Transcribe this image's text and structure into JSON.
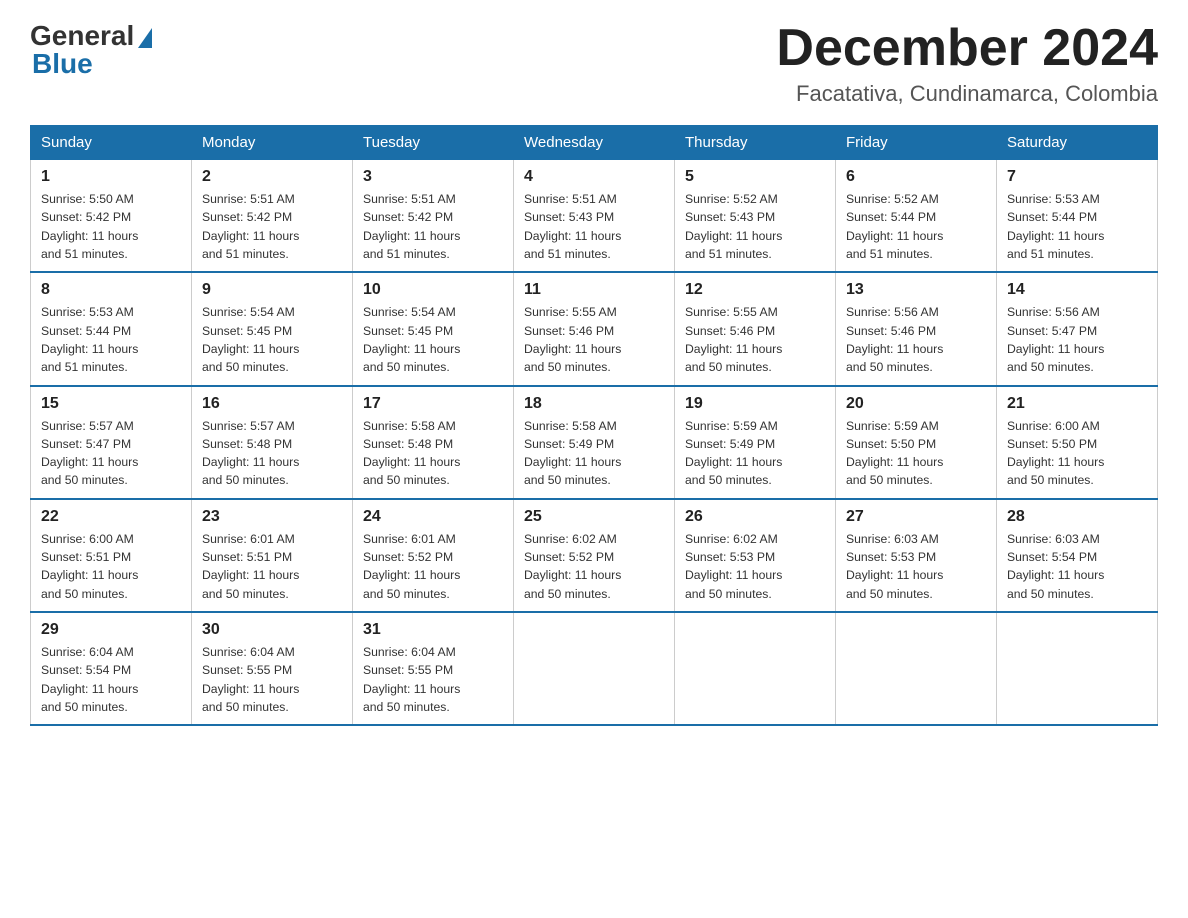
{
  "logo": {
    "general": "General",
    "blue": "Blue"
  },
  "title": "December 2024",
  "subtitle": "Facatativa, Cundinamarca, Colombia",
  "days_of_week": [
    "Sunday",
    "Monday",
    "Tuesday",
    "Wednesday",
    "Thursday",
    "Friday",
    "Saturday"
  ],
  "weeks": [
    [
      {
        "day": "1",
        "sunrise": "5:50 AM",
        "sunset": "5:42 PM",
        "daylight": "11 hours and 51 minutes."
      },
      {
        "day": "2",
        "sunrise": "5:51 AM",
        "sunset": "5:42 PM",
        "daylight": "11 hours and 51 minutes."
      },
      {
        "day": "3",
        "sunrise": "5:51 AM",
        "sunset": "5:42 PM",
        "daylight": "11 hours and 51 minutes."
      },
      {
        "day": "4",
        "sunrise": "5:51 AM",
        "sunset": "5:43 PM",
        "daylight": "11 hours and 51 minutes."
      },
      {
        "day": "5",
        "sunrise": "5:52 AM",
        "sunset": "5:43 PM",
        "daylight": "11 hours and 51 minutes."
      },
      {
        "day": "6",
        "sunrise": "5:52 AM",
        "sunset": "5:44 PM",
        "daylight": "11 hours and 51 minutes."
      },
      {
        "day": "7",
        "sunrise": "5:53 AM",
        "sunset": "5:44 PM",
        "daylight": "11 hours and 51 minutes."
      }
    ],
    [
      {
        "day": "8",
        "sunrise": "5:53 AM",
        "sunset": "5:44 PM",
        "daylight": "11 hours and 51 minutes."
      },
      {
        "day": "9",
        "sunrise": "5:54 AM",
        "sunset": "5:45 PM",
        "daylight": "11 hours and 50 minutes."
      },
      {
        "day": "10",
        "sunrise": "5:54 AM",
        "sunset": "5:45 PM",
        "daylight": "11 hours and 50 minutes."
      },
      {
        "day": "11",
        "sunrise": "5:55 AM",
        "sunset": "5:46 PM",
        "daylight": "11 hours and 50 minutes."
      },
      {
        "day": "12",
        "sunrise": "5:55 AM",
        "sunset": "5:46 PM",
        "daylight": "11 hours and 50 minutes."
      },
      {
        "day": "13",
        "sunrise": "5:56 AM",
        "sunset": "5:46 PM",
        "daylight": "11 hours and 50 minutes."
      },
      {
        "day": "14",
        "sunrise": "5:56 AM",
        "sunset": "5:47 PM",
        "daylight": "11 hours and 50 minutes."
      }
    ],
    [
      {
        "day": "15",
        "sunrise": "5:57 AM",
        "sunset": "5:47 PM",
        "daylight": "11 hours and 50 minutes."
      },
      {
        "day": "16",
        "sunrise": "5:57 AM",
        "sunset": "5:48 PM",
        "daylight": "11 hours and 50 minutes."
      },
      {
        "day": "17",
        "sunrise": "5:58 AM",
        "sunset": "5:48 PM",
        "daylight": "11 hours and 50 minutes."
      },
      {
        "day": "18",
        "sunrise": "5:58 AM",
        "sunset": "5:49 PM",
        "daylight": "11 hours and 50 minutes."
      },
      {
        "day": "19",
        "sunrise": "5:59 AM",
        "sunset": "5:49 PM",
        "daylight": "11 hours and 50 minutes."
      },
      {
        "day": "20",
        "sunrise": "5:59 AM",
        "sunset": "5:50 PM",
        "daylight": "11 hours and 50 minutes."
      },
      {
        "day": "21",
        "sunrise": "6:00 AM",
        "sunset": "5:50 PM",
        "daylight": "11 hours and 50 minutes."
      }
    ],
    [
      {
        "day": "22",
        "sunrise": "6:00 AM",
        "sunset": "5:51 PM",
        "daylight": "11 hours and 50 minutes."
      },
      {
        "day": "23",
        "sunrise": "6:01 AM",
        "sunset": "5:51 PM",
        "daylight": "11 hours and 50 minutes."
      },
      {
        "day": "24",
        "sunrise": "6:01 AM",
        "sunset": "5:52 PM",
        "daylight": "11 hours and 50 minutes."
      },
      {
        "day": "25",
        "sunrise": "6:02 AM",
        "sunset": "5:52 PM",
        "daylight": "11 hours and 50 minutes."
      },
      {
        "day": "26",
        "sunrise": "6:02 AM",
        "sunset": "5:53 PM",
        "daylight": "11 hours and 50 minutes."
      },
      {
        "day": "27",
        "sunrise": "6:03 AM",
        "sunset": "5:53 PM",
        "daylight": "11 hours and 50 minutes."
      },
      {
        "day": "28",
        "sunrise": "6:03 AM",
        "sunset": "5:54 PM",
        "daylight": "11 hours and 50 minutes."
      }
    ],
    [
      {
        "day": "29",
        "sunrise": "6:04 AM",
        "sunset": "5:54 PM",
        "daylight": "11 hours and 50 minutes."
      },
      {
        "day": "30",
        "sunrise": "6:04 AM",
        "sunset": "5:55 PM",
        "daylight": "11 hours and 50 minutes."
      },
      {
        "day": "31",
        "sunrise": "6:04 AM",
        "sunset": "5:55 PM",
        "daylight": "11 hours and 50 minutes."
      },
      null,
      null,
      null,
      null
    ]
  ],
  "labels": {
    "sunrise": "Sunrise:",
    "sunset": "Sunset:",
    "daylight": "Daylight:"
  }
}
